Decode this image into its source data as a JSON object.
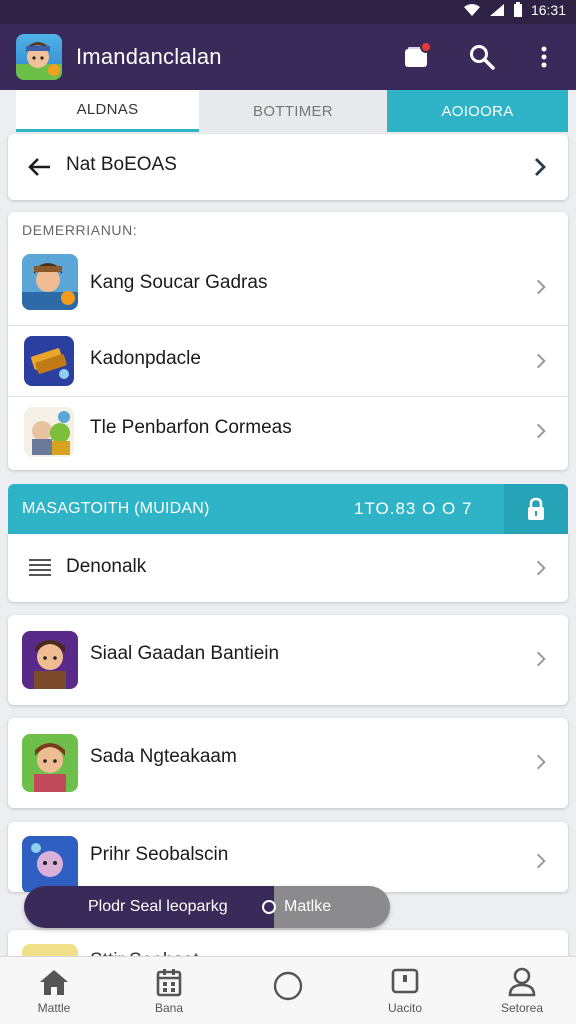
{
  "status_bar": {
    "time": "16:31"
  },
  "app_bar": {
    "title": "Imandanclalan"
  },
  "tabs": [
    {
      "label": "ALDNAS"
    },
    {
      "label": "BOTTIMER"
    },
    {
      "label": "AOIOORA"
    }
  ],
  "nav_row": {
    "label": "Nat BoEOAS"
  },
  "list_section": {
    "header": "DEMERRIANUN:",
    "items": [
      {
        "label": "Kang Soucar Gadras"
      },
      {
        "label": "Kadonpdacle"
      },
      {
        "label": "Tle Penbarfon Cormeas"
      }
    ]
  },
  "teal_section": {
    "title": "MASAGTOITH (MUIDAN)",
    "count": "1TO.83  O O 7",
    "row_label": "Denonalk"
  },
  "game_cards": [
    {
      "label": "Siaal Gaadan Bantiein"
    },
    {
      "label": "Sada Ngteakaam"
    },
    {
      "label": "Prihr Seobalscin"
    }
  ],
  "snackbar": {
    "label": "Plodr Seal leoparkg",
    "action": "Matlke"
  },
  "peek_card": {
    "label": "Sttir Seehsat"
  },
  "bottom_nav": [
    {
      "label": "Mattle",
      "icon": "home-icon"
    },
    {
      "label": "Bana",
      "icon": "calendar-icon"
    },
    {
      "label": "",
      "icon": "circle-icon"
    },
    {
      "label": "Uacito",
      "icon": "device-icon"
    },
    {
      "label": "Setorea",
      "icon": "person-icon"
    }
  ],
  "colors": {
    "app_bar": "#3a2a5a",
    "accent": "#2fb3c7",
    "badge": "#e53935"
  }
}
